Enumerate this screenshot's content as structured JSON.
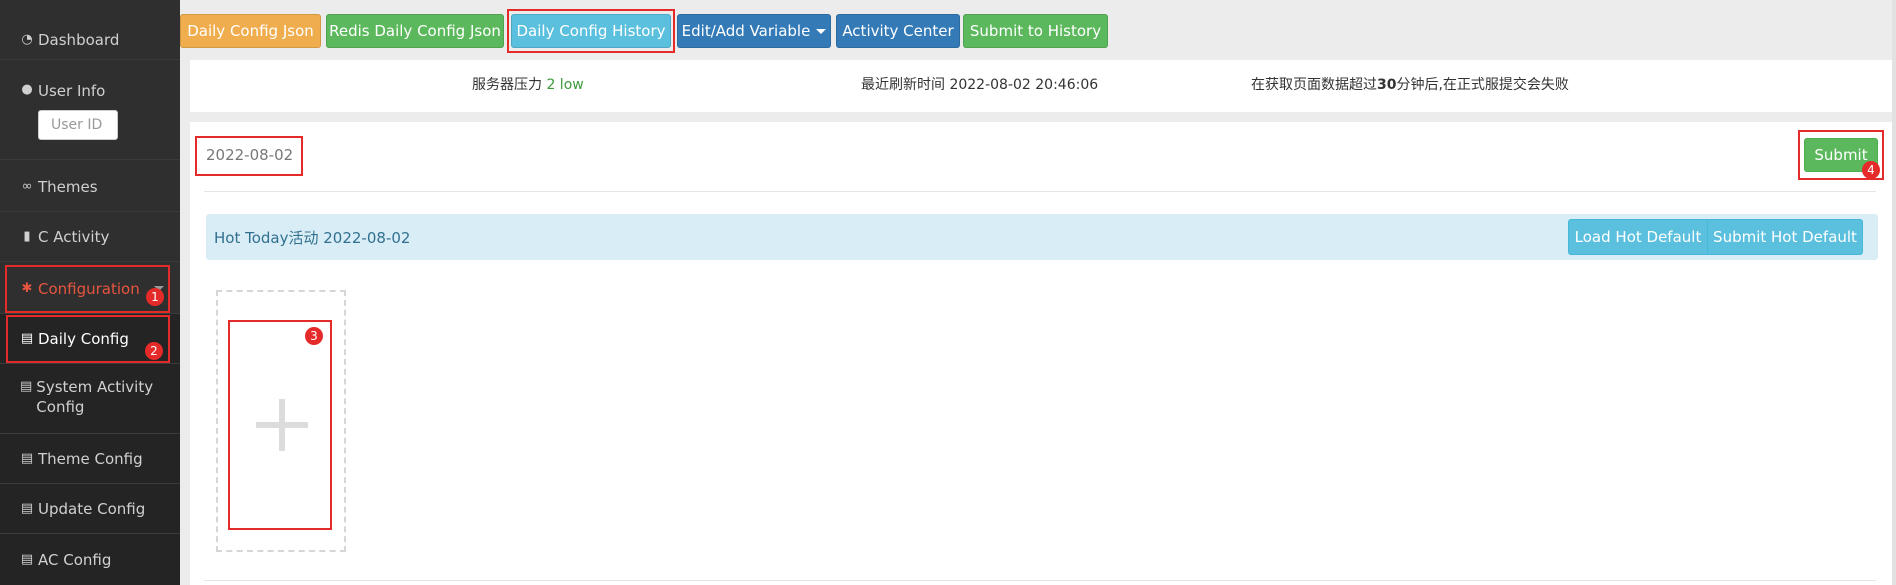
{
  "sidebar": {
    "items": [
      {
        "label": "Dashboard",
        "icon": "dashboard-icon"
      },
      {
        "label": "User Info",
        "icon": "user-icon"
      },
      {
        "label": "Themes",
        "icon": "glasses-icon"
      },
      {
        "label": "C Activity",
        "icon": "book-icon"
      },
      {
        "label": "Configuration",
        "icon": "gear-icon"
      },
      {
        "label": "Daily Config",
        "icon": "list-icon"
      },
      {
        "label": "System Activity Config",
        "icon": "list-icon"
      },
      {
        "label": "Theme Config",
        "icon": "list-icon"
      },
      {
        "label": "Update Config",
        "icon": "list-icon"
      },
      {
        "label": "AC Config",
        "icon": "list-icon"
      }
    ],
    "user_id_placeholder": "User ID"
  },
  "toolbar": {
    "daily_config_json": "Daily Config Json",
    "redis_daily_config_json": "Redis Daily Config Json",
    "daily_config_history": "Daily Config History",
    "edit_add_variable": "Edit/Add Variable",
    "activity_center": "Activity Center",
    "submit_to_history": "Submit to History"
  },
  "status": {
    "pressure_label": "服务器压力",
    "pressure_value": "2 low",
    "refresh_label": "最近刷新时间",
    "refresh_value": "2022-08-02 20:46:06",
    "warning_prefix": "在获取页面数据超过",
    "warning_bold": "30",
    "warning_suffix": "分钟后,在正式服提交会失败"
  },
  "main": {
    "date": "2022-08-02",
    "submit_label": "Submit",
    "hot_title": "Hot Today活动 2022-08-02",
    "load_hot_default": "Load Hot Default",
    "submit_hot_default": "Submit Hot Default"
  },
  "annotations": [
    "1",
    "2",
    "3",
    "4"
  ],
  "colors": {
    "sidebar_bg": "#2f2f2f",
    "active_red": "#e8553f",
    "annotation_red": "#e52a2a",
    "success": "#5cb85c",
    "info": "#5bc0de",
    "primary": "#337ab7",
    "warning": "#f0ad4e"
  }
}
